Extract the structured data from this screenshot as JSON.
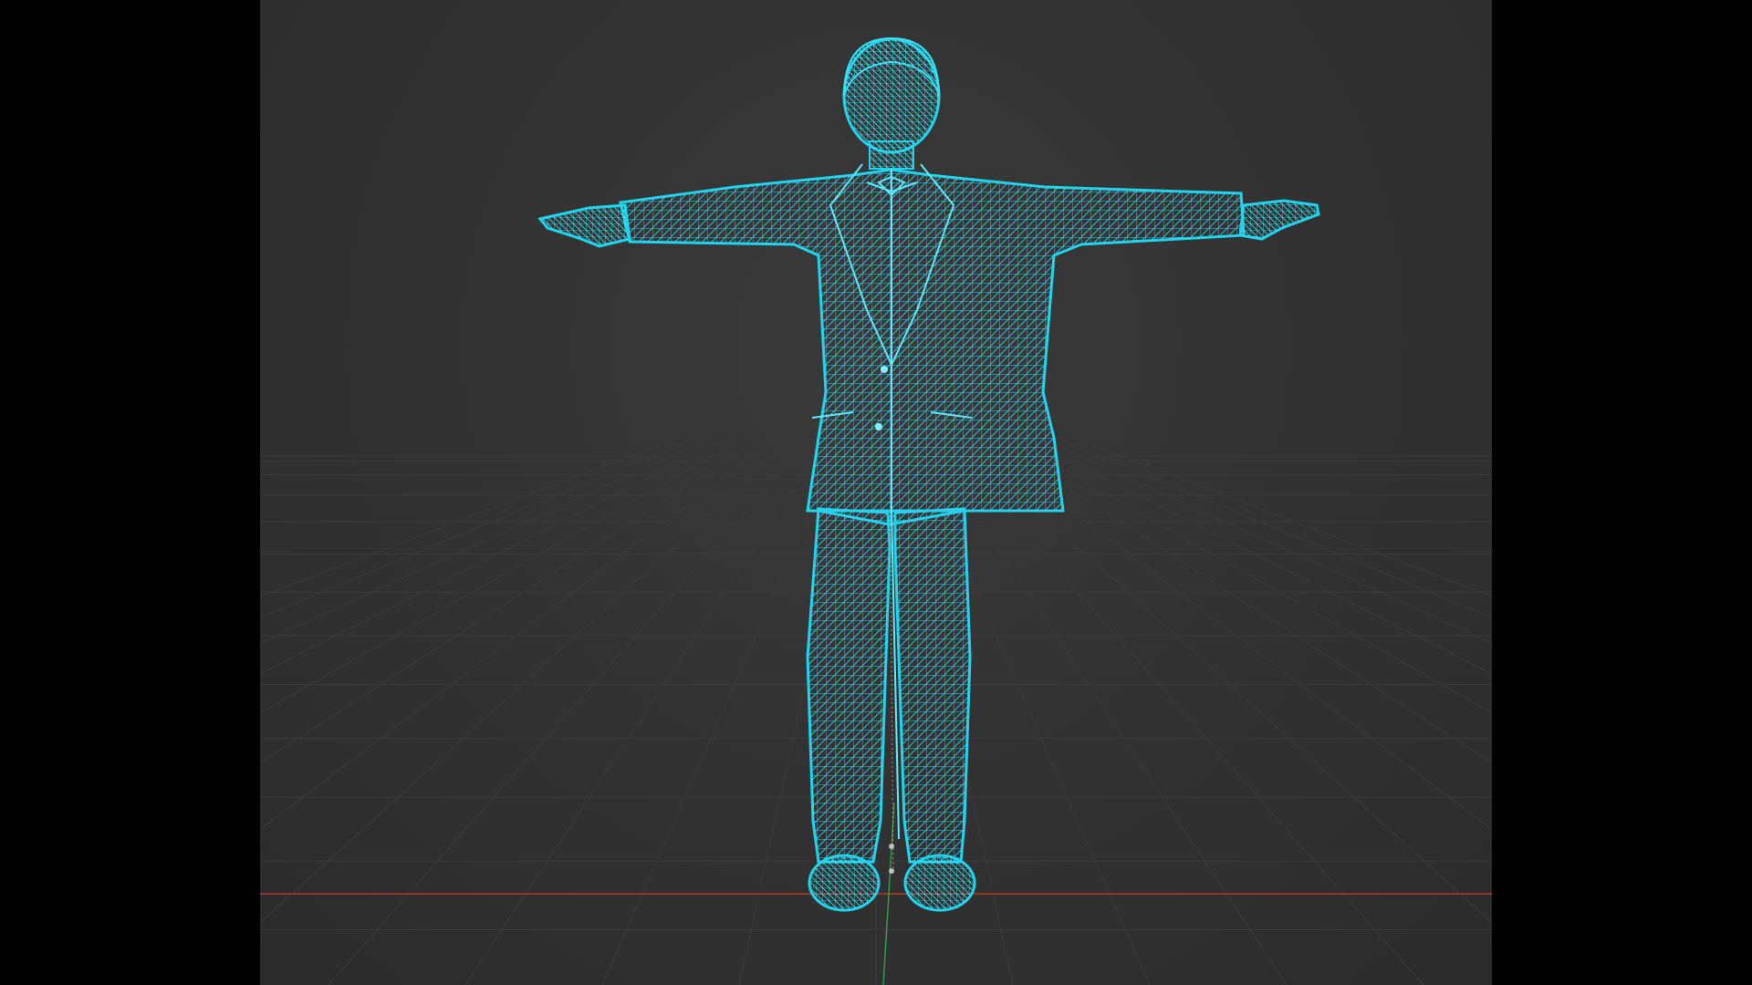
{
  "viewport": {
    "view": "front-orthographic",
    "shading": "wireframe",
    "object": "character-mesh-in-suit",
    "pose": "T-pose"
  },
  "colors": {
    "background": "#333333",
    "grid_line": "#3c3c3c",
    "wireframe": "#22d3ee",
    "wireframe_dense": "#16b8d4",
    "x_axis": "#c0392b",
    "y_axis": "#2ea84a",
    "letterbox": "#000000"
  },
  "icons": {
    "origin": "origin-dot-icon"
  }
}
